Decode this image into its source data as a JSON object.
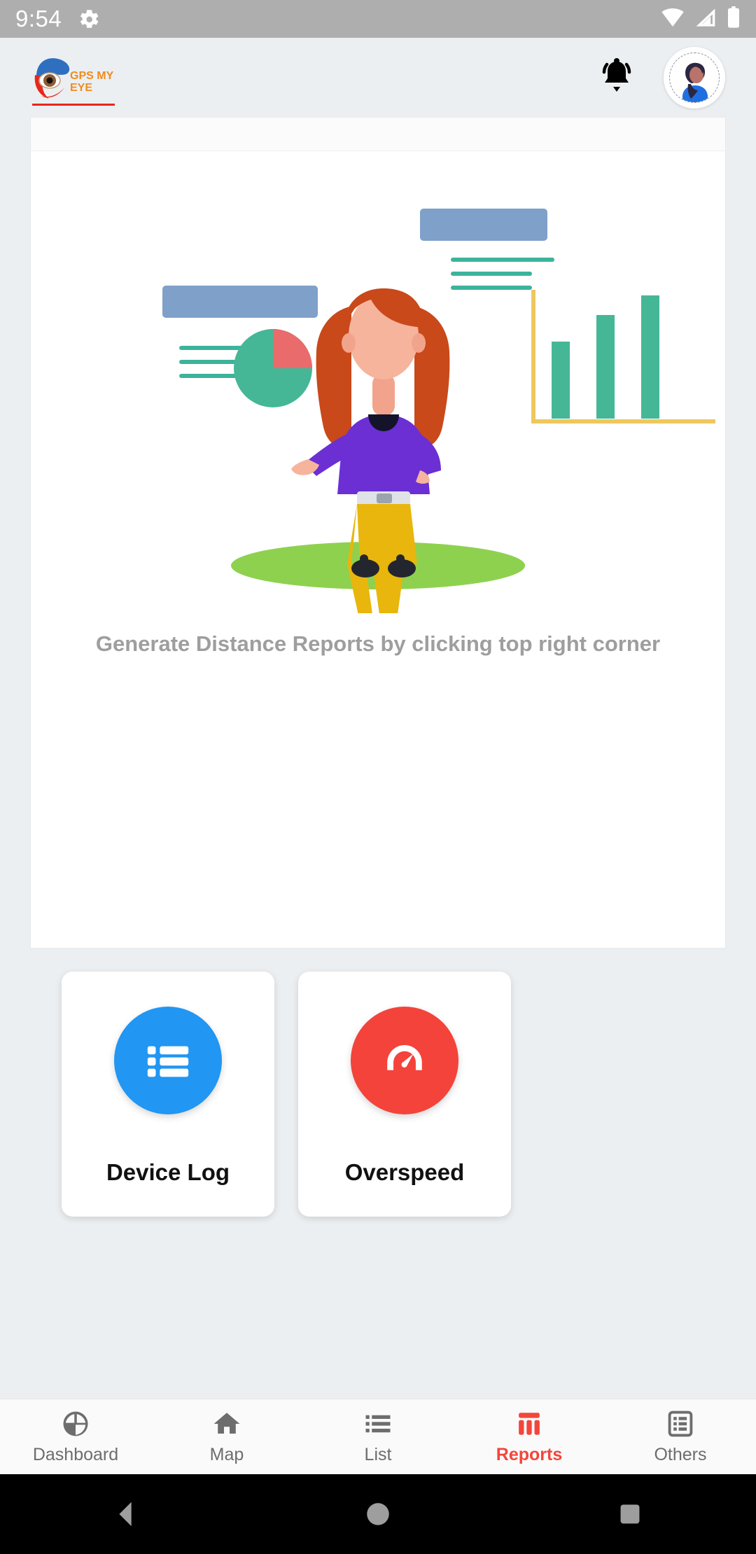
{
  "statusbar": {
    "time": "9:54",
    "icons": [
      "gear-icon",
      "wifi-icon",
      "cellular-signal-icon",
      "battery-icon"
    ]
  },
  "appbar": {
    "logo_line1": "GPS MY",
    "logo_line2": "EYE",
    "logo_color": "#f08c1e",
    "notification_icon": "bell-icon",
    "avatar_icon": "user-avatar"
  },
  "main": {
    "empty_message": "Generate Distance Reports by clicking top right corner",
    "illustration": "analytics-presentation-illustration"
  },
  "tiles": [
    {
      "label": "Device Log",
      "icon": "list-icon",
      "color": "#2196f3"
    },
    {
      "label": "Overspeed",
      "icon": "speedometer-icon",
      "color": "#f4433b"
    }
  ],
  "bottomnav": {
    "active_color": "#f4453c",
    "inactive_color": "#6d6d6d",
    "items": [
      {
        "label": "Dashboard",
        "icon": "pie-chart-icon",
        "active": false
      },
      {
        "label": "Map",
        "icon": "home-icon",
        "active": false
      },
      {
        "label": "List",
        "icon": "list-bullet-icon",
        "active": false
      },
      {
        "label": "Reports",
        "icon": "bar-chart-icon",
        "active": true
      },
      {
        "label": "Others",
        "icon": "list-card-icon",
        "active": false
      }
    ]
  },
  "androidnav": {
    "items": [
      {
        "name": "back-button",
        "icon": "triangle-left-icon"
      },
      {
        "name": "home-button",
        "icon": "circle-icon"
      },
      {
        "name": "recents-button",
        "icon": "square-icon"
      }
    ]
  }
}
